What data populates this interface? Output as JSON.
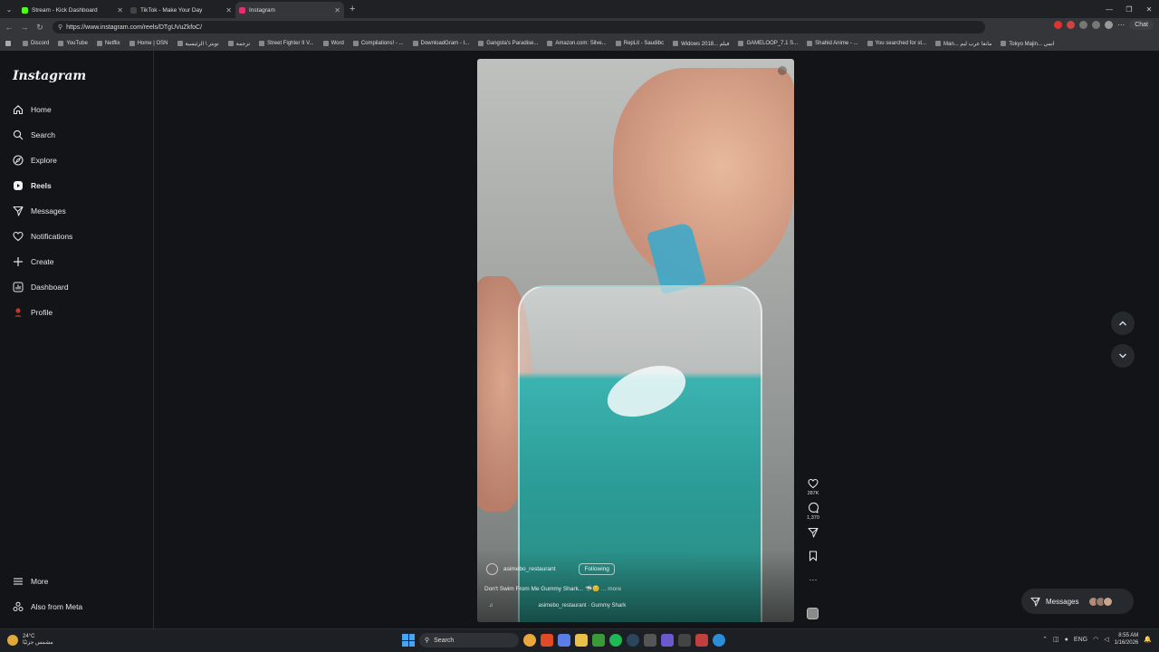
{
  "browser": {
    "tabs": [
      {
        "label": "Stream - Kick Dashboard",
        "color": "#53fc18"
      },
      {
        "label": "TikTok - Make Your Day",
        "color": "#111111"
      },
      {
        "label": "Instagram",
        "color": "#e1306c"
      }
    ],
    "new_tab": "+",
    "url": "https://www.instagram.com/reels/DTgUVuZkfoC/",
    "chat_label": "Chat",
    "bookmarks": [
      "Discord",
      "YouTube",
      "Netflix",
      "Home | OSN",
      "تويتر \\ الرئيسية",
      "ترجمة",
      "Street Fighter II V...",
      "Word",
      "Compilations! - ...",
      "DownloadGram - I...",
      "Gangsta's Paradise...",
      "Amazon.com: Silve...",
      "RepLit - Saudibc",
      "Widows 2018... فيلم",
      "GAMELOOP_7.1 S...",
      "Shahid Anime - ...",
      "You searched for st...",
      "Man... مانغا عرب ليم",
      "Tokyo Majin... انمي"
    ]
  },
  "sidebar": {
    "logo": "Instagram",
    "items": [
      {
        "label": "Home",
        "icon": "home-icon"
      },
      {
        "label": "Search",
        "icon": "search-icon"
      },
      {
        "label": "Explore",
        "icon": "compass-icon"
      },
      {
        "label": "Reels",
        "icon": "reels-icon"
      },
      {
        "label": "Messages",
        "icon": "paper-plane-icon"
      },
      {
        "label": "Notifications",
        "icon": "heart-icon"
      },
      {
        "label": "Create",
        "icon": "plus-icon"
      },
      {
        "label": "Dashboard",
        "icon": "chart-icon"
      },
      {
        "label": "Profile",
        "icon": "avatar-icon"
      }
    ],
    "more": "More",
    "meta": "Also from Meta"
  },
  "reel": {
    "username": "asimebo_restaurant",
    "follow_label": "Following",
    "caption": "Don't Swim From Me Gummy Shark...",
    "caption_emoji": "🦈😊",
    "more_label": "... more",
    "audio": "asimebo_restaurant · Gummy Shark",
    "likes": "287K",
    "comments": "1,370"
  },
  "messages_pill": {
    "label": "Messages"
  },
  "taskbar": {
    "weather_temp": "24°C",
    "weather_desc": "مشمس جزئيًا",
    "search": "Search",
    "lang": "ENG",
    "time": "8:55 AM",
    "date": "1/16/2026"
  }
}
